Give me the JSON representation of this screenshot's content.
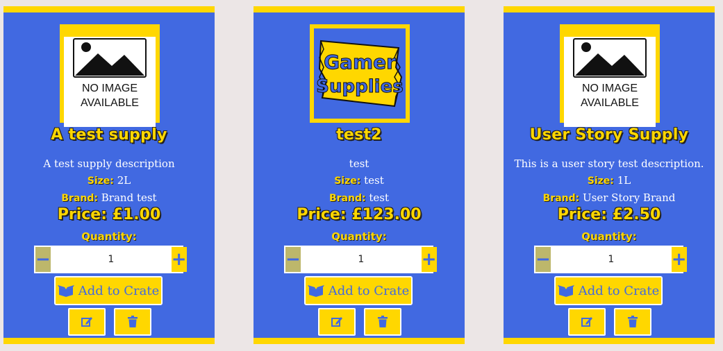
{
  "products": [
    {
      "image_kind": "no-image",
      "no_image_line1": "NO IMAGE",
      "no_image_line2": "AVAILABLE",
      "title": "A test supply",
      "description": "A test supply description",
      "size_label": "Size:",
      "size": "2L",
      "brand_label": "Brand:",
      "brand": "Brand test",
      "price": "Price: £1.00",
      "quantity_label": "Quantity:",
      "quantity": "1",
      "minus": "−",
      "plus": "+",
      "add_label": "Add to Crate",
      "edit_icon": "edit-icon",
      "delete_icon": "trash-icon"
    },
    {
      "image_kind": "brand-logo",
      "logo_line1": "Gamer",
      "logo_line2": "Supplies",
      "title": "test2",
      "description": "test",
      "size_label": "Size:",
      "size": "test",
      "brand_label": "Brand:",
      "brand": "test",
      "price": "Price: £123.00",
      "quantity_label": "Quantity:",
      "quantity": "1",
      "minus": "−",
      "plus": "+",
      "add_label": "Add to Crate",
      "edit_icon": "edit-icon",
      "delete_icon": "trash-icon"
    },
    {
      "image_kind": "no-image",
      "no_image_line1": "NO IMAGE",
      "no_image_line2": "AVAILABLE",
      "title": "User Story Supply",
      "description": "This is a user story test description.",
      "size_label": "Size:",
      "size": "1L",
      "brand_label": "Brand:",
      "brand": "User Story Brand",
      "price": "Price: £2.50",
      "quantity_label": "Quantity:",
      "quantity": "1",
      "minus": "−",
      "plus": "+",
      "add_label": "Add to Crate",
      "edit_icon": "edit-icon",
      "delete_icon": "trash-icon"
    }
  ],
  "colors": {
    "background": "#ece6e6",
    "card": "#4169e1",
    "accent": "#ffd700",
    "minus_bg": "#bdb76b"
  }
}
